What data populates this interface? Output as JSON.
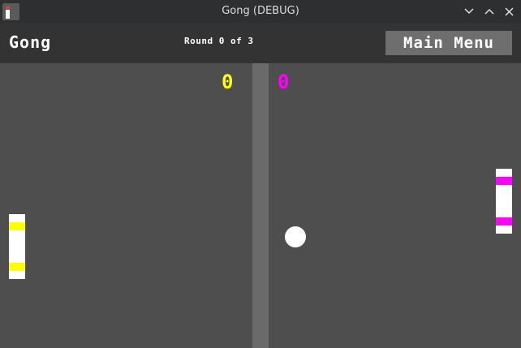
{
  "window": {
    "title": "Gong (DEBUG)",
    "controls": [
      "minimize",
      "maximize",
      "close"
    ]
  },
  "header": {
    "title": "Gong",
    "round_text": "Round 0 of 3",
    "main_menu_label": "Main Menu"
  },
  "game": {
    "left_player": {
      "score": "0",
      "color": "#ffff00"
    },
    "right_player": {
      "score": "0",
      "color": "#ff00ff"
    },
    "paddle_color": "#ffffff",
    "ball_color": "#ffffff",
    "field_color": "#4e4e4e",
    "net_color": "#6a6a6a"
  }
}
